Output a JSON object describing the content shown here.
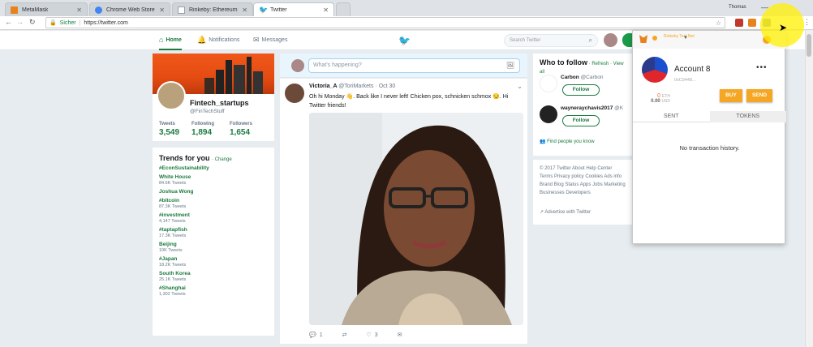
{
  "browser": {
    "tabs": [
      {
        "label": "MetaMask",
        "favicon_color": "#e8821e"
      },
      {
        "label": "Chrome Web Store - Exte",
        "favicon_color": "#4285f4"
      },
      {
        "label": "Rinkeby: Ethereum Testn",
        "favicon_color": "#9aa0a6"
      },
      {
        "label": "Twitter",
        "favicon_color": "#1da1f2"
      }
    ],
    "user_label": "Thomas",
    "secure_label": "Sicher",
    "url": "https://twitter.com"
  },
  "twitter": {
    "nav": {
      "home": "Home",
      "notifications": "Notifications",
      "messages": "Messages"
    },
    "search_placeholder": "Search Twitter",
    "profile": {
      "name": "Fintech_startups",
      "handle": "@FinTechStuff",
      "stats": [
        {
          "label": "Tweets",
          "value": "3,549"
        },
        {
          "label": "Following",
          "value": "1,894"
        },
        {
          "label": "Followers",
          "value": "1,654"
        }
      ]
    },
    "trends": {
      "title": "Trends for you",
      "change": "· Change",
      "items": [
        {
          "name": "#EconSustainability",
          "count": ""
        },
        {
          "name": "White House",
          "count": "84.6K Tweets"
        },
        {
          "name": "Joshua Wong",
          "count": ""
        },
        {
          "name": "#bitcoin",
          "count": "87.3K Tweets"
        },
        {
          "name": "#investment",
          "count": "4,147 Tweets"
        },
        {
          "name": "#taptapfish",
          "count": "17.3K Tweets"
        },
        {
          "name": "Beijing",
          "count": "10K Tweets"
        },
        {
          "name": "#Japan",
          "count": "18.2K Tweets"
        },
        {
          "name": "South Korea",
          "count": "25.1K Tweets"
        },
        {
          "name": "#Shanghai",
          "count": "1,302 Tweets"
        }
      ]
    },
    "compose_placeholder": "What's happening?",
    "tweet": {
      "name": "Victoria_A",
      "handle": "@ToriMarkets · Oct 30",
      "text": "Oh hi Monday 👋. Back like I never left! Chicken pox, schnicken schmox 😏. Hi Twitter friends!",
      "replies": "1",
      "likes": "3"
    },
    "who_to_follow": {
      "title": "Who to follow",
      "links": " · Refresh · View all",
      "items": [
        {
          "name": "Carbon",
          "handle": "@Carbon",
          "follow": "Follow"
        },
        {
          "name": "wayneraychavis2017",
          "handle": "@K",
          "follow": "Follow"
        }
      ],
      "find": "Find people you know"
    },
    "footer": {
      "text": "© 2017 Twitter  About  Help Center  Terms  Privacy policy  Cookies  Ads info  Brand  Blog  Status  Apps  Jobs  Marketing  Businesses  Developers",
      "advertise": "Advertise with Twitter"
    }
  },
  "metamask": {
    "network": "Rinkeby Test Net",
    "account_name": "Account 8",
    "address": "0xC9448...",
    "balance_eth": "0",
    "balance_eth_unit": "ETH",
    "balance_usd": "0.00",
    "balance_usd_unit": "USD",
    "buy": "BUY",
    "send": "SEND",
    "tab_sent": "SENT",
    "tab_tokens": "TOKENS",
    "empty": "No transaction history.",
    "accent": "#f5a623"
  }
}
